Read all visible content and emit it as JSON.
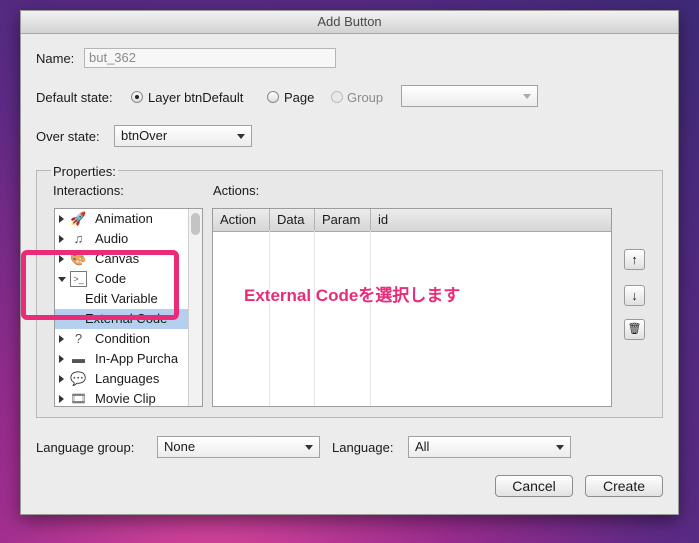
{
  "window": {
    "title": "Add Button"
  },
  "name": {
    "label": "Name:",
    "value": "but_362"
  },
  "default_state": {
    "label": "Default state:",
    "options": [
      {
        "label": "Layer btnDefault",
        "selected": true,
        "enabled": true
      },
      {
        "label": "Page",
        "selected": false,
        "enabled": true
      },
      {
        "label": "Group",
        "selected": false,
        "enabled": false
      }
    ],
    "group_select_value": ""
  },
  "over_state": {
    "label": "Over state:",
    "value": "btnOver"
  },
  "properties": {
    "legend": "Properties:",
    "interactions_label": "Interactions:",
    "actions_label": "Actions:",
    "tree": [
      {
        "label": "Animation",
        "icon": "rocket-icon",
        "glyph": "🚀",
        "expanded": false,
        "child": false,
        "selected": false
      },
      {
        "label": "Audio",
        "icon": "music-note-icon",
        "glyph": "♫",
        "expanded": false,
        "child": false,
        "selected": false
      },
      {
        "label": "Canvas",
        "icon": "palette-icon",
        "glyph": "🎨",
        "expanded": false,
        "child": false,
        "selected": false
      },
      {
        "label": "Code",
        "icon": "terminal-icon",
        "glyph": ">_",
        "expanded": true,
        "child": false,
        "selected": false
      },
      {
        "label": "Edit Variable",
        "icon": "",
        "glyph": "",
        "expanded": false,
        "child": true,
        "selected": false
      },
      {
        "label": "External Code",
        "icon": "",
        "glyph": "",
        "expanded": false,
        "child": true,
        "selected": true
      },
      {
        "label": "Condition",
        "icon": "condition-icon",
        "glyph": "?",
        "expanded": false,
        "child": false,
        "selected": false
      },
      {
        "label": "In-App Purcha",
        "icon": "card-icon",
        "glyph": "▬",
        "expanded": false,
        "child": false,
        "selected": false
      },
      {
        "label": "Languages",
        "icon": "speech-bubble-icon",
        "glyph": "💬",
        "expanded": false,
        "child": false,
        "selected": false
      },
      {
        "label": "Movie Clip",
        "icon": "film-icon",
        "glyph": "🎞",
        "expanded": false,
        "child": false,
        "selected": false
      }
    ],
    "actions_columns": [
      "Action",
      "Data",
      "Param",
      "id"
    ]
  },
  "annotation": "External Codeを選択します",
  "language_group": {
    "label": "Language group:",
    "value": "None"
  },
  "language": {
    "label": "Language:",
    "value": "All"
  },
  "buttons": {
    "cancel": "Cancel",
    "create": "Create",
    "up": "↑",
    "down": "↓",
    "delete": "🗑"
  }
}
